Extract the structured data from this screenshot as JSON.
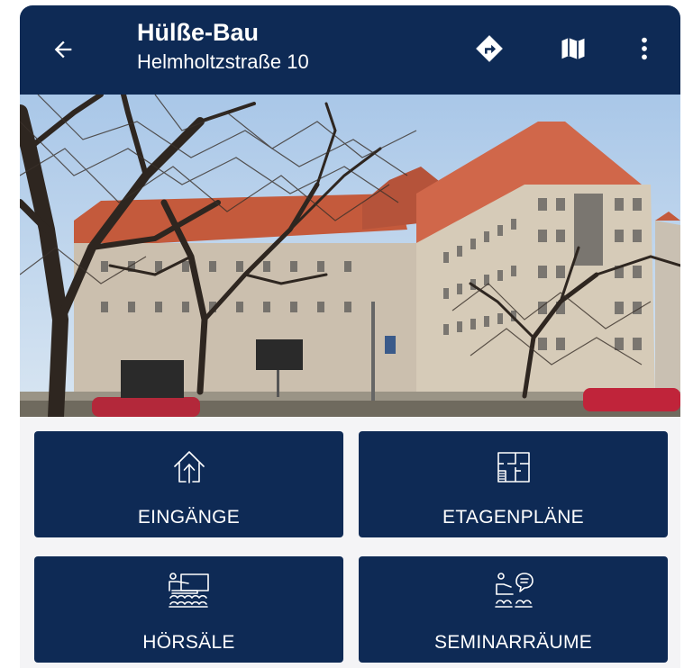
{
  "header": {
    "title": "Hülße-Bau",
    "subtitle": "Helmholtzstraße 10",
    "icons": [
      "arrow-left-icon",
      "directions-icon",
      "map-icon",
      "more-vert-icon"
    ]
  },
  "photo": {
    "alt": "Hülße-Bau"
  },
  "tiles": [
    {
      "label": "EINGÄNGE",
      "icon": "entrance-icon"
    },
    {
      "label": "ETAGENPLÄNE",
      "icon": "floorplan-icon"
    },
    {
      "label": "HÖRSÄLE",
      "icon": "lecture-hall-icon"
    },
    {
      "label": "SEMINARRÄUME",
      "icon": "seminar-room-icon"
    }
  ],
  "colors": {
    "primary": "#0e2a55",
    "background": "#f4f4f6",
    "text": "#ffffff"
  }
}
